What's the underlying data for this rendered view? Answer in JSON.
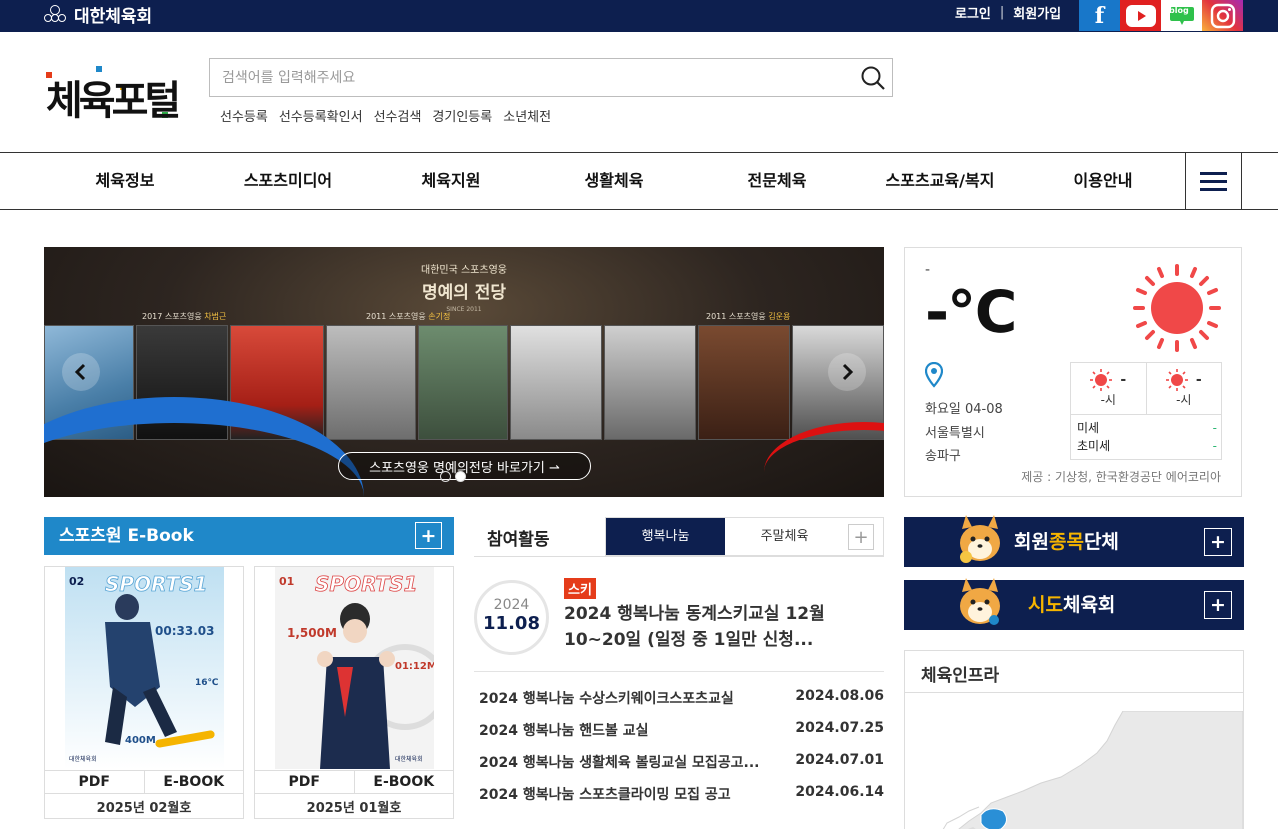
{
  "topbar": {
    "org_name": "대한체육회",
    "login": "로그인",
    "separator": "|",
    "signup": "회원가입",
    "sns": [
      "facebook-icon",
      "youtube-icon",
      "blog-icon",
      "instagram-icon"
    ],
    "blog_text": "blog",
    "facebook_letter": "f"
  },
  "header": {
    "logo_text": "체육포털",
    "search_placeholder": "검색어를 입력해주세요",
    "quick_links": [
      "선수등록",
      "선수등록확인서",
      "선수검색",
      "경기인등록",
      "소년체전"
    ]
  },
  "gnb": {
    "items": [
      "체육정보",
      "스포츠미디어",
      "체육지원",
      "생활체육",
      "전문체육",
      "스포츠교육/복지",
      "이용안내"
    ]
  },
  "banner": {
    "hall_sub": "대한민국 스포츠영웅",
    "hall_title": "명예의 전당",
    "hall_since": "SINCE 2011",
    "tag_left": "2017 스포츠영웅",
    "tag_left_name": "차범근",
    "tag_mid": "2011 스포츠영웅",
    "tag_mid_name": "손기정",
    "tag_right": "2011 스포츠영웅",
    "tag_right_name": "김운용",
    "cta": "스포츠영웅 명예의전당 바로가기 ⇀",
    "slide_count": 2,
    "active_slide": 2
  },
  "weather": {
    "small_dash": "-",
    "temperature": "-℃",
    "date": "화요일  04-08",
    "city": "서울특별시",
    "district": "송파구",
    "forecast": [
      {
        "value": "-",
        "time": "-시"
      },
      {
        "value": "-",
        "time": "-시"
      }
    ],
    "air_quality": [
      {
        "label": "미세",
        "value": "-"
      },
      {
        "label": "초미세",
        "value": "-"
      }
    ],
    "source": "제공 : 기상청, 한국환경공단 에어코리아"
  },
  "ebook": {
    "title": "스포츠원 E-Book",
    "issues": [
      {
        "number": "02",
        "pdf": "PDF",
        "ebook": "E-BOOK",
        "label": "2025년 02월호"
      },
      {
        "number": "01",
        "pdf": "PDF",
        "ebook": "E-BOOK",
        "label": "2025년 01월호"
      }
    ],
    "cover_masthead": "SPORTS1",
    "cover1_time": "00:33.03",
    "cover1_temp": "16℃",
    "cover1_distance": "400M",
    "cover2_distance": "1,500M",
    "cover2_time": "01:12M",
    "cover_publisher": "대한체육회"
  },
  "participation": {
    "title": "참여활동",
    "tabs": [
      "행복나눔",
      "주말체육"
    ],
    "active_tab": 0,
    "featured": {
      "year": "2024",
      "date": "11.08",
      "badge": "스키",
      "title": "2024 행복나눔 동계스키교실 12월 10~20일 (일정 중 1일만 신청..."
    },
    "news": [
      {
        "title": "2024 행복나눔 수상스키웨이크스포츠교실",
        "date": "2024.08.06"
      },
      {
        "title": "2024 행복나눔 핸드볼 교실",
        "date": "2024.07.25"
      },
      {
        "title": "2024 행복나눔 생활체육 볼링교실 모집공고...",
        "date": "2024.07.01"
      },
      {
        "title": "2024 행복나눔 스포츠클라이밍 모집 공고",
        "date": "2024.06.14"
      }
    ]
  },
  "side_banners": [
    {
      "pre": "회원",
      "highlight": "종목",
      "post": "단체"
    },
    {
      "pre": "",
      "highlight": "시도",
      "post": "체육회"
    }
  ],
  "infra": {
    "title": "체육인프라"
  },
  "colors": {
    "navy": "#0d1f4f",
    "ebook_blue": "#1f88c9",
    "ski_badge": "#e53c1a",
    "sun_red": "#f04848",
    "accent_yellow": "#f5b400"
  }
}
